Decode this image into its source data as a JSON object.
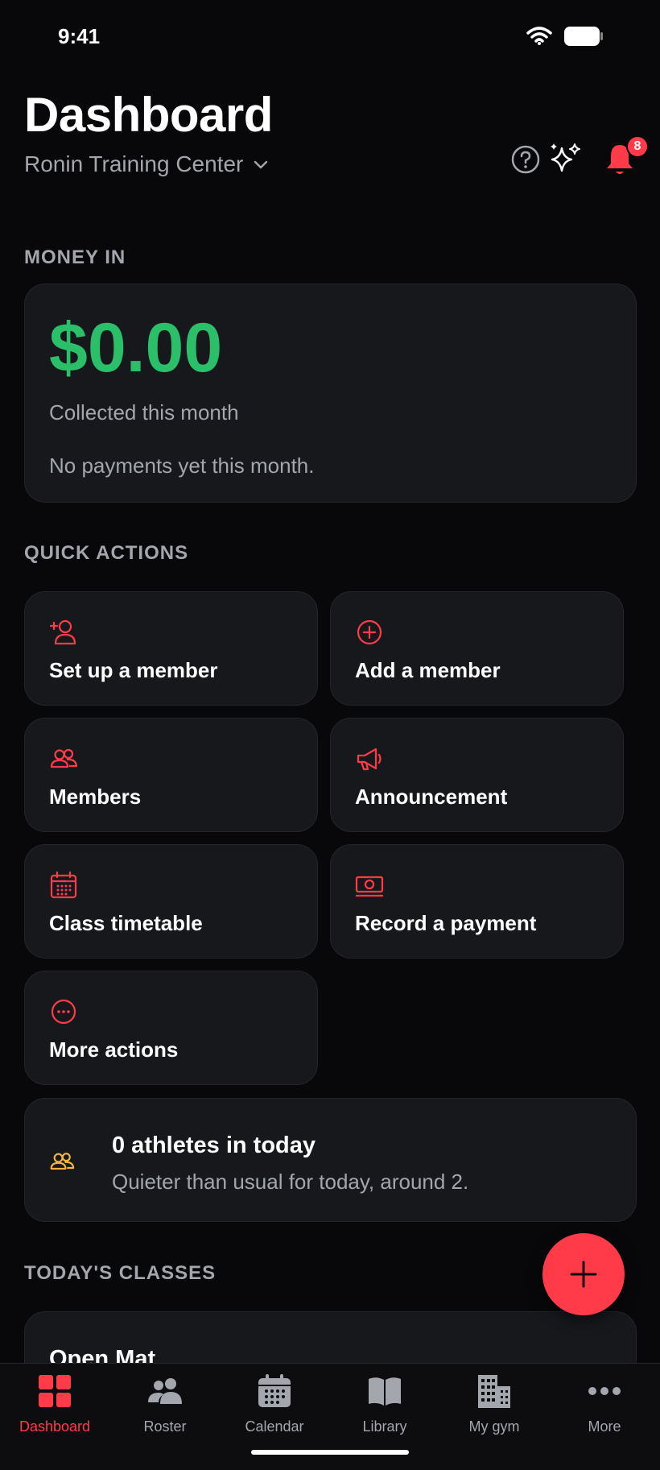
{
  "status_bar": {
    "time": "9:41"
  },
  "header": {
    "title": "Dashboard",
    "gym_name": "Ronin Training Center",
    "notification_count": "8"
  },
  "money_in": {
    "section_label": "MONEY IN",
    "amount": "$0.00",
    "subtitle": "Collected this month",
    "note": "No payments yet this month."
  },
  "quick_actions": {
    "section_label": "QUICK ACTIONS",
    "items": [
      {
        "label": "Set up a member",
        "icon": "user-plus-icon"
      },
      {
        "label": "Add a member",
        "icon": "plus-circle-icon"
      },
      {
        "label": "Members",
        "icon": "users-icon"
      },
      {
        "label": "Announcement",
        "icon": "megaphone-icon"
      },
      {
        "label": "Class timetable",
        "icon": "calendar-icon"
      },
      {
        "label": "Record a payment",
        "icon": "cash-icon"
      },
      {
        "label": "More actions",
        "icon": "more-circle-icon"
      }
    ]
  },
  "athletes": {
    "title": "0 athletes in today",
    "subtitle": "Quieter than usual for today, around 2."
  },
  "todays_classes": {
    "section_label": "TODAY'S CLASSES",
    "items": [
      {
        "name": "Open Mat"
      }
    ]
  },
  "tabs": [
    {
      "label": "Dashboard",
      "icon": "grid-icon",
      "active": true
    },
    {
      "label": "Roster",
      "icon": "people-icon",
      "active": false
    },
    {
      "label": "Calendar",
      "icon": "calendar-icon",
      "active": false
    },
    {
      "label": "Library",
      "icon": "book-icon",
      "active": false
    },
    {
      "label": "My gym",
      "icon": "building-icon",
      "active": false
    },
    {
      "label": "More",
      "icon": "more-dots-icon",
      "active": false
    }
  ],
  "colors": {
    "accent": "#ff3b4a",
    "money": "#2bbf6a",
    "athletes_icon": "#f2b640",
    "background": "#08080a",
    "card": "#17181c",
    "muted_text": "#a3a6ad"
  }
}
